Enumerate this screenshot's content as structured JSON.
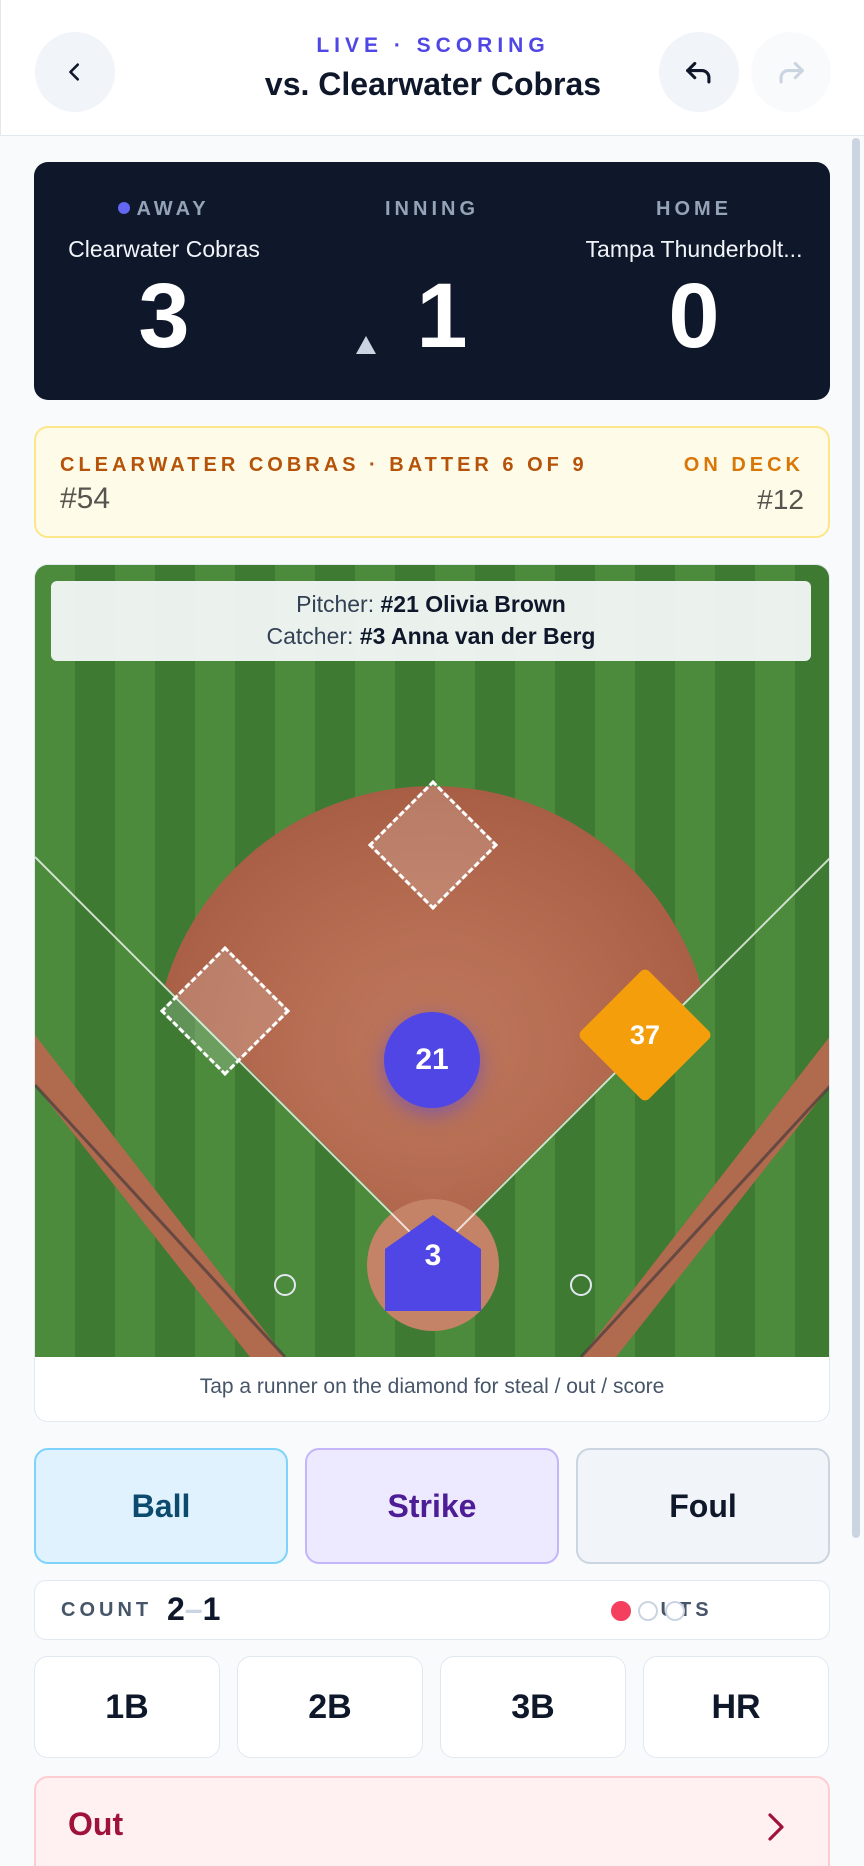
{
  "header": {
    "subtitle": "LIVE · SCORING",
    "title": "vs. Clearwater Cobras",
    "back_icon": "chevron-left-icon",
    "undo_icon": "undo-icon",
    "redo_icon": "redo-icon"
  },
  "scoreboard": {
    "away_label": "AWAY",
    "away_team": "Clearwater Cobras",
    "away_score": "3",
    "inning_label": "INNING",
    "inning_value": "1",
    "inning_half": "top",
    "home_label": "HOME",
    "home_team": "Tampa Thunderbolt...",
    "home_score": "0",
    "batting_indicator_color": "#6366f1"
  },
  "batter": {
    "label": "CLEARWATER COBRAS · BATTER 6 OF 9",
    "number": "#54",
    "on_deck_label": "ON DECK",
    "on_deck_number": "#12"
  },
  "field": {
    "pitcher_label": "Pitcher:",
    "pitcher_name": "#21 Olivia Brown",
    "catcher_label": "Catcher:",
    "catcher_name": "#3 Anna van der Berg",
    "pitcher_token": "21",
    "catcher_token": "3",
    "third_base_runner": "37",
    "hint": "Tap a runner on the diamond for steal / out / score"
  },
  "pitch_buttons": {
    "ball": "Ball",
    "strike": "Strike",
    "foul": "Foul"
  },
  "count": {
    "label": "COUNT",
    "balls": "2",
    "separator": "–",
    "strikes": "1",
    "outs_label": "OUTS",
    "outs": 1,
    "outs_max": 3
  },
  "hit_buttons": [
    "1B",
    "2B",
    "3B",
    "HR"
  ],
  "out_button": {
    "label": "Out",
    "icon": "chevron-right-icon"
  },
  "colors": {
    "accent": "#4f46e5",
    "runner": "#f59e0b",
    "out": "#f43f5e"
  }
}
